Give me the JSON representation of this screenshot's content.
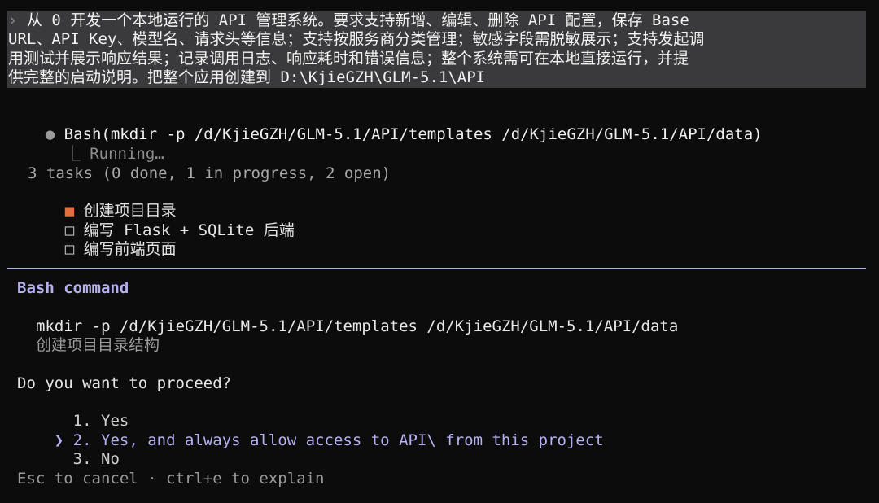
{
  "prompt": {
    "chevron": "›",
    "lines": [
      "从 0 开发一个本地运行的 API 管理系统。要求支持新增、编辑、删除 API 配置，保存 Base",
      "URL、API Key、模型名、请求头等信息；支持按服务商分类管理；敏感字段需脱敏展示；支持发起调",
      "用测试并展示响应结果；记录调用日志、响应耗时和错误信息；整个系统需可在本地直接运行，并提",
      "供完整的启动说明。把整个应用创建到 D:\\KjieGZH\\GLM-5.1\\API"
    ]
  },
  "tool_call": {
    "bullet": "●",
    "name": "Bash(mkdir -p /d/KjieGZH/GLM-5.1/API/templates /d/KjieGZH/GLM-5.1/API/data)",
    "tree_glyph": "⎿",
    "status": "Running…"
  },
  "tasks": {
    "summary": "3 tasks (0 done, 1 in progress, 2 open)",
    "items": [
      {
        "icon": "■",
        "label": "创建项目目录",
        "state": "in_progress"
      },
      {
        "icon": "□",
        "label": "编写 Flask + SQLite 后端",
        "state": "open"
      },
      {
        "icon": "□",
        "label": "编写前端页面",
        "state": "open"
      }
    ]
  },
  "permission": {
    "title": "Bash command",
    "command": "mkdir -p /d/KjieGZH/GLM-5.1/API/templates /d/KjieGZH/GLM-5.1/API/data",
    "description": "创建项目目录结构",
    "question": "Do you want to proceed?",
    "selector": "❯",
    "options": [
      {
        "number": "1.",
        "label": "Yes",
        "selected": false
      },
      {
        "number": "2.",
        "label": "Yes, and always allow access to API\\ from this project",
        "selected": true
      },
      {
        "number": "3.",
        "label": "No",
        "selected": false
      }
    ],
    "footer": "Esc to cancel · ctrl+e to explain"
  },
  "colors": {
    "background": "#0c0c0d",
    "prompt_highlight": "#3a3a3c",
    "accent": "#b5b1f0",
    "task_active": "#e0703f"
  }
}
